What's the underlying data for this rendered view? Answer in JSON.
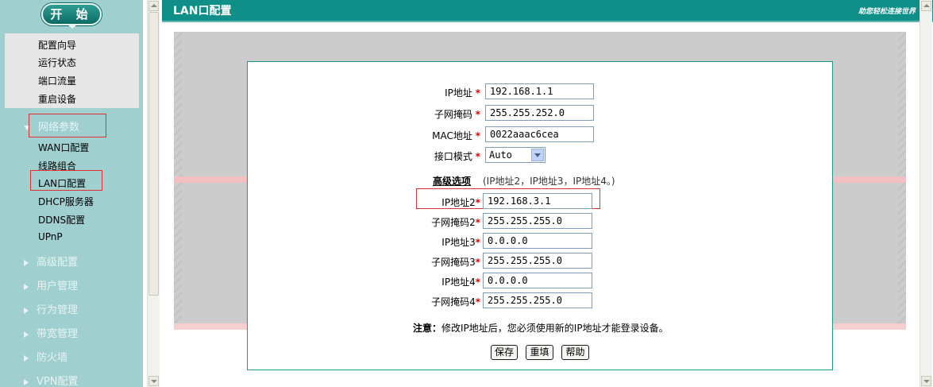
{
  "sidebar": {
    "start_label": "开 始",
    "top_items": [
      {
        "label": "配置向导"
      },
      {
        "label": "运行状态"
      },
      {
        "label": "端口流量"
      },
      {
        "label": "重启设备"
      }
    ],
    "network_section": "网络参数",
    "network_items": [
      {
        "label": "WAN口配置"
      },
      {
        "label": "线路组合"
      },
      {
        "label": "LAN口配置"
      },
      {
        "label": "DHCP服务器"
      },
      {
        "label": "DDNS配置"
      },
      {
        "label": "UPnP"
      }
    ],
    "sections": [
      {
        "label": "高级配置"
      },
      {
        "label": "用户管理"
      },
      {
        "label": "行为管理"
      },
      {
        "label": "带宽管理"
      },
      {
        "label": "防火墙"
      },
      {
        "label": "VPN配置"
      }
    ]
  },
  "header": {
    "title": "LAN口配置",
    "slogan": "助您轻松连接世界"
  },
  "form": {
    "ip_label": "IP地址",
    "ip_value": "192.168.1.1",
    "mask_label": "子网掩码",
    "mask_value": "255.255.252.0",
    "mac_label": "MAC地址",
    "mac_value": "0022aaac6cea",
    "mode_label": "接口模式",
    "mode_value": "Auto",
    "required_mark": "*",
    "advanced_title": "高级选项",
    "advanced_hint": "(IP地址2，IP地址3，IP地址4。)",
    "ip2_label": "IP地址2",
    "ip2_value": "192.168.3.1",
    "mask2_label": "子网掩码2",
    "mask2_value": "255.255.255.0",
    "ip3_label": "IP地址3",
    "ip3_value": "0.0.0.0",
    "mask3_label": "子网掩码3",
    "mask3_value": "255.255.255.0",
    "ip4_label": "IP地址4",
    "ip4_value": "0.0.0.0",
    "mask4_label": "子网掩码4",
    "mask4_value": "255.255.255.0",
    "note_label": "注意：",
    "note_text": "修改IP地址后，您必须使用新的IP地址才能登录设备。",
    "save_label": "保存",
    "reset_label": "重填",
    "help_label": "帮助"
  },
  "colors": {
    "header_bg": "#0f8f88",
    "sidebar_bg": "#9fcfcf",
    "highlight_box": "#e03030",
    "required": "#e00000"
  }
}
